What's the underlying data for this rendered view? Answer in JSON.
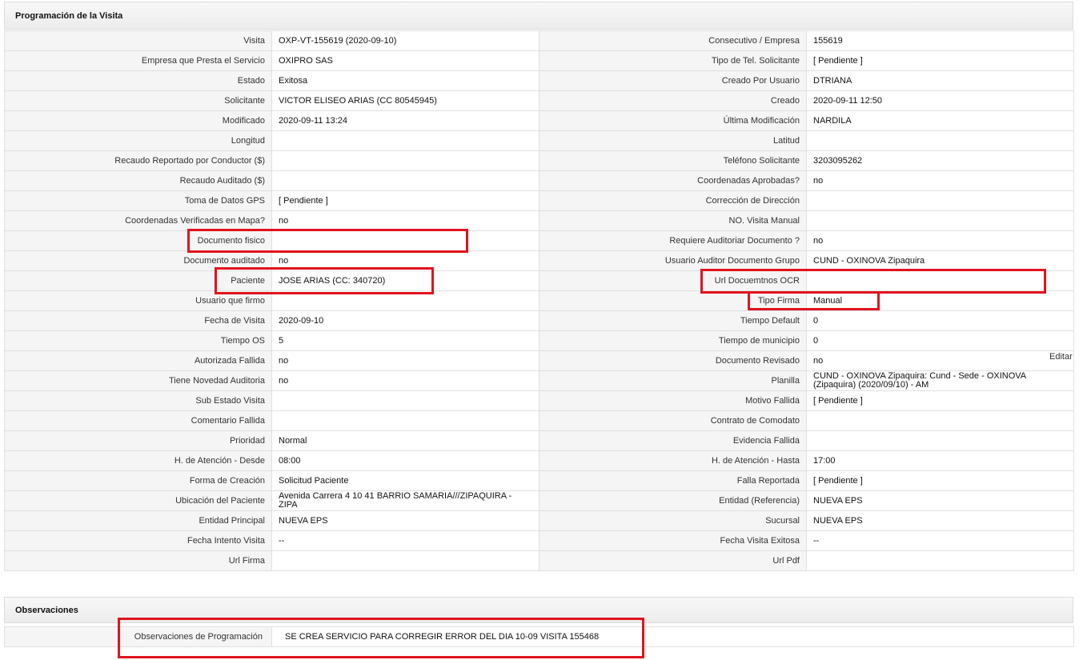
{
  "sections": {
    "programacion_title": "Programación de la Visita",
    "observaciones_title": "Observaciones"
  },
  "rows": [
    {
      "l1": "Visita",
      "v1": "OXP-VT-155619 (2020-09-10)",
      "l2": "Consecutivo / Empresa",
      "v2": "155619"
    },
    {
      "l1": "Empresa que Presta el Servicio",
      "v1": "OXIPRO SAS",
      "l2": "Tipo de Tel. Solicitante",
      "v2": "[ Pendiente ]"
    },
    {
      "l1": "Estado",
      "v1": "Exitosa",
      "l2": "Creado Por Usuario",
      "v2": "DTRIANA"
    },
    {
      "l1": "Solicitante",
      "v1": "VICTOR ELISEO ARIAS (CC 80545945)",
      "l2": "Creado",
      "v2": "2020-09-11 12:50"
    },
    {
      "l1": "Modificado",
      "v1": "2020-09-11 13:24",
      "l2": "Última Modificación",
      "v2": " NARDILA"
    },
    {
      "l1": "Longitud",
      "v1": "",
      "l2": "Latitud",
      "v2": ""
    },
    {
      "l1": "Recaudo Reportado por Conductor ($)",
      "v1": "",
      "l2": "Teléfono Solicitante",
      "v2": "3203095262"
    },
    {
      "l1": "Recaudo Auditado ($)",
      "v1": "",
      "l2": "Coordenadas Aprobadas?",
      "v2": " no"
    },
    {
      "l1": "Toma de Datos GPS",
      "v1": "[ Pendiente ]",
      "l2": "Corrección de Dirección",
      "v2": ""
    },
    {
      "l1": "Coordenadas Verificadas en Mapa?",
      "v1": " no",
      "l2": "NO. Visita Manual",
      "v2": ""
    },
    {
      "l1": "Documento fisico",
      "v1": "",
      "l2": "Requiere Auditoriar Documento ?",
      "v2": " no"
    },
    {
      "l1": "Documento auditado",
      "v1": " no",
      "l2": "Usuario Auditor Documento Grupo",
      "v2": "CUND - OXINOVA Zipaquira"
    },
    {
      "l1": "Paciente",
      "v1": "JOSE ARIAS (CC: 340720)",
      "l2": "Url Docuemtnos OCR",
      "v2": ""
    },
    {
      "l1": "Usuario que firmo",
      "v1": "",
      "l2": "Tipo Firma",
      "v2": "Manual"
    },
    {
      "l1": "Fecha de Visita",
      "v1": " 2020-09-10",
      "l2": "Tiempo Default",
      "v2": "0"
    },
    {
      "l1": "Tiempo OS",
      "v1": "5",
      "l2": "Tiempo de municipio",
      "v2": "0"
    },
    {
      "l1": "Autorizada Fallida",
      "v1": " no",
      "l2": "Documento Revisado",
      "v2": " no"
    },
    {
      "l1": "Tiene Novedad Auditoria",
      "v1": " no",
      "l2": "Planilla",
      "v2": "CUND - OXINOVA Zipaquira: Cund - Sede - OXINOVA (Zipaquira) (2020/09/10) - AM"
    },
    {
      "l1": "Sub Estado Visita",
      "v1": "",
      "l2": "Motivo Fallida",
      "v2": "[ Pendiente ]"
    },
    {
      "l1": "Comentario Fallida",
      "v1": "",
      "l2": "Contrato de Comodato",
      "v2": ""
    },
    {
      "l1": "Prioridad",
      "v1": "Normal",
      "l2": "Evidencia Fallida",
      "v2": ""
    },
    {
      "l1": "H. de Atención - Desde",
      "v1": "08:00",
      "l2": "H. de Atención - Hasta",
      "v2": "17:00"
    },
    {
      "l1": "Forma de Creación",
      "v1": "Solicitud Paciente",
      "l2": "Falla Reportada",
      "v2": "[ Pendiente ]"
    },
    {
      "l1": "Ubicación del Paciente",
      "v1": "Avenida Carrera 4 10 41 BARRIO SAMARIA///ZIPAQUIRA - ZIPA",
      "l2": "Entidad (Referencia)",
      "v2": "NUEVA EPS"
    },
    {
      "l1": "Entidad Principal",
      "v1": "NUEVA EPS",
      "l2": "Sucursal",
      "v2": "NUEVA EPS"
    },
    {
      "l1": "Fecha Intento Visita",
      "v1": " --",
      "l2": "Fecha Visita Exitosa",
      "v2": " --"
    },
    {
      "l1": "Url Firma",
      "v1": "",
      "l2": "Url Pdf",
      "v2": ""
    }
  ],
  "edit_label": "Editar",
  "observaciones": {
    "label": "Observaciones de Programación",
    "value": "SE CREA SERVICIO PARA CORREGIR ERROR DEL DIA 10-09 VISITA 155468"
  },
  "colors": {
    "highlight": "#e0141e",
    "label_bg": "#f5f5f5",
    "border": "#e0e0e0"
  }
}
